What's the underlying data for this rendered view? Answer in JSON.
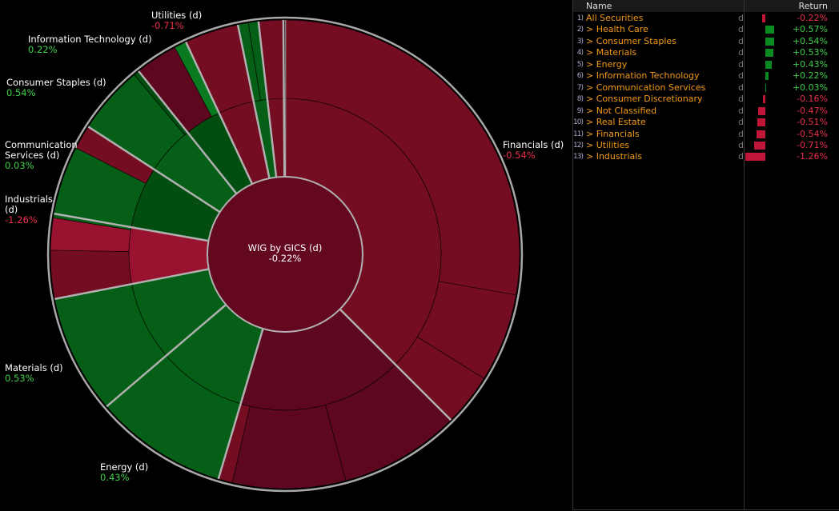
{
  "chart_data": {
    "type": "sunburst",
    "title": "WIG by GICS (d)",
    "center_value": "-0.22%",
    "colors": {
      "pos_dark": "#024d10",
      "pos": "#055f16",
      "pos_bright": "#0a7a20",
      "neg_dark": "#5e0820",
      "neg": "#740c22",
      "neg_bright": "#991230",
      "center": "#640820"
    },
    "sectors": [
      {
        "name": "Financials (d)",
        "value": "-0.54%",
        "weight": 135,
        "inner": "neg",
        "outer": [
          [
            100,
            "neg"
          ],
          [
            22,
            "neg"
          ],
          [
            13,
            "neg"
          ]
        ]
      },
      {
        "name": "Consumer Discretionary (d)",
        "value": "-0.16%",
        "weight": 61.5,
        "inner": "neg_dark",
        "outer": [
          [
            30,
            "neg_dark"
          ],
          [
            28,
            "neg_dark"
          ],
          [
            3.5,
            "neg"
          ]
        ]
      },
      {
        "name": "Energy (d)",
        "value": "0.43%",
        "weight": 33,
        "inner": "pos",
        "outer": [
          [
            33,
            "pos"
          ]
        ]
      },
      {
        "name": "Materials (d)",
        "value": "0.53%",
        "weight": 29.5,
        "inner": "pos",
        "outer": [
          [
            29.5,
            "pos"
          ]
        ]
      },
      {
        "name": "Industrials (d)",
        "value": "-1.26%",
        "weight": 21,
        "inner": "neg_bright",
        "outer": [
          [
            12,
            "neg"
          ],
          [
            8,
            "neg_bright"
          ],
          [
            1,
            "pos"
          ]
        ]
      },
      {
        "name": "Communication Services (d)",
        "value": "0.03%",
        "weight": 23,
        "inner": "pos_dark",
        "outer": [
          [
            17,
            "pos"
          ],
          [
            6,
            "neg"
          ]
        ]
      },
      {
        "name": "Consumer Staples (d)",
        "value": "0.54%",
        "weight": 18.4,
        "inner": "pos",
        "outer": [
          [
            17,
            "pos"
          ],
          [
            1.4,
            "pos_dark"
          ]
        ]
      },
      {
        "name": "Information Technology (d)",
        "value": "0.22%",
        "weight": 13.6,
        "inner": "pos_dark",
        "outer": [
          [
            10.6,
            "neg_dark"
          ],
          [
            3,
            "pos_bright"
          ]
        ]
      },
      {
        "name": "Utilities (d)",
        "value": "-0.71%",
        "weight": 13.4,
        "inner": "neg",
        "outer": [
          [
            13.4,
            "neg"
          ]
        ]
      },
      {
        "name": "Health Care (d)",
        "value": "0.57%",
        "weight": 5.1,
        "inner": "pos",
        "outer": [
          [
            2.6,
            "pos"
          ],
          [
            2.5,
            "pos"
          ]
        ]
      },
      {
        "name": "Real Estate (d)",
        "value": "-0.51%",
        "weight": 6.1,
        "inner": "neg",
        "outer": [
          [
            6.1,
            "neg"
          ]
        ]
      },
      {
        "name": "Not Classified (d)",
        "value": "-0.47%",
        "weight": 0.4,
        "inner": "neg",
        "outer": [
          [
            0.4,
            "neg"
          ]
        ]
      }
    ]
  },
  "table": {
    "headers": {
      "name": "Name",
      "return": "Return"
    },
    "rows": [
      {
        "idx": "1)",
        "name": "All Securities",
        "d": "d",
        "ret": "-0.22%",
        "val": -0.22
      },
      {
        "idx": "2)",
        "name": "> Health Care",
        "d": "d",
        "ret": "+0.57%",
        "val": 0.57
      },
      {
        "idx": "3)",
        "name": "> Consumer Staples",
        "d": "d",
        "ret": "+0.54%",
        "val": 0.54
      },
      {
        "idx": "4)",
        "name": "> Materials",
        "d": "d",
        "ret": "+0.53%",
        "val": 0.53
      },
      {
        "idx": "5)",
        "name": "> Energy",
        "d": "d",
        "ret": "+0.43%",
        "val": 0.43
      },
      {
        "idx": "6)",
        "name": "> Information Technology",
        "d": "d",
        "ret": "+0.22%",
        "val": 0.22
      },
      {
        "idx": "7)",
        "name": "> Communication Services",
        "d": "d",
        "ret": "+0.03%",
        "val": 0.03
      },
      {
        "idx": "8)",
        "name": "> Consumer Discretionary",
        "d": "d",
        "ret": "-0.16%",
        "val": -0.16
      },
      {
        "idx": "9)",
        "name": "> Not Classified",
        "d": "d",
        "ret": "-0.47%",
        "val": -0.47
      },
      {
        "idx": "10)",
        "name": "> Real Estate",
        "d": "d",
        "ret": "-0.51%",
        "val": -0.51
      },
      {
        "idx": "11)",
        "name": "> Financials",
        "d": "d",
        "ret": "-0.54%",
        "val": -0.54
      },
      {
        "idx": "12)",
        "name": "> Utilities",
        "d": "d",
        "ret": "-0.71%",
        "val": -0.71
      },
      {
        "idx": "13)",
        "name": "> Industrials",
        "d": "d",
        "ret": "-1.26%",
        "val": -1.26
      }
    ]
  }
}
